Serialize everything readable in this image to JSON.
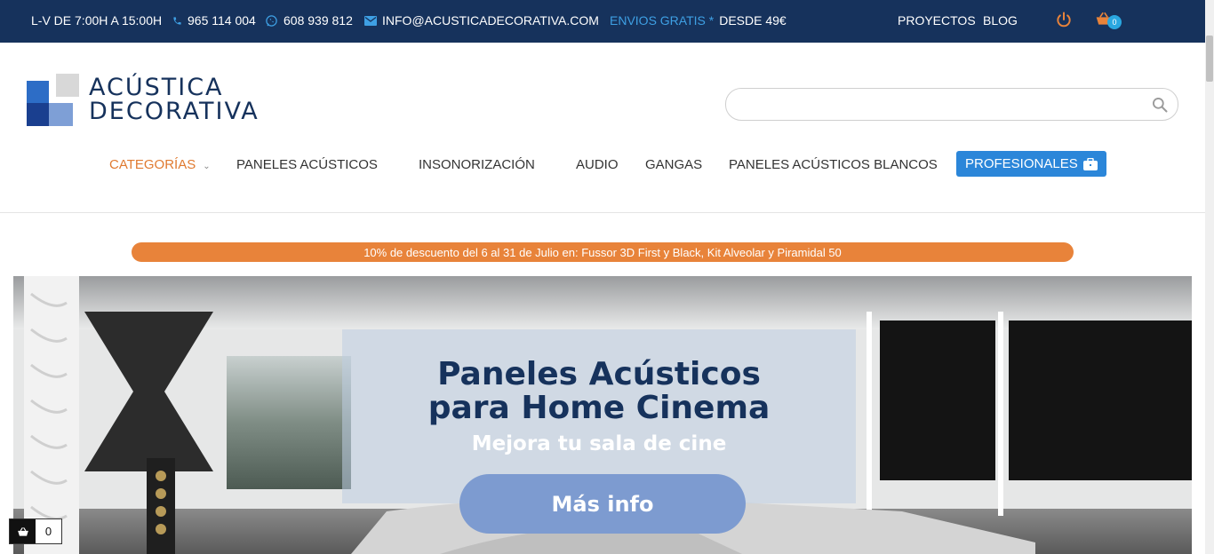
{
  "topbar": {
    "hours": "L-V DE 7:00H A 15:00H",
    "phone": "965 114 004",
    "whatsapp": "608 939 812",
    "email": "INFO@ACUSTICADECORATIVA.COM",
    "shipping_accent": "ENVIOS GRATIS *",
    "shipping_rest": "DESDE 49€",
    "proyectos": "PROYECTOS",
    "blog": "BLOG",
    "cart_count": "0"
  },
  "logo": {
    "line1": "ACÚSTICA",
    "line2": "DECORATIVA"
  },
  "search": {
    "value": "",
    "placeholder": ""
  },
  "nav": {
    "categorias": "CATEGORÍAS",
    "paneles": "PANELES ACÚSTICOS",
    "insonorizacion": "INSONORIZACIÓN",
    "audio": "AUDIO",
    "gangas": "GANGAS",
    "blancos": "PANELES ACÚSTICOS BLANCOS",
    "profesionales": "PROFESIONALES"
  },
  "promo": {
    "text": "10% de descuento del 6 al 31 de Julio en: Fussor 3D First y Black, Kit Alveolar y Piramidal 50"
  },
  "hero": {
    "title_line1": "Paneles Acústicos",
    "title_line2": "para Home Cinema",
    "subtitle": "Mejora tu sala de cine",
    "button": "Más info"
  },
  "mini_cart": {
    "count": "0"
  },
  "colors": {
    "topbar": "#16325c",
    "accent_blue": "#3ea0e4",
    "orange": "#e8833a",
    "pro_button": "#2b86d9"
  }
}
